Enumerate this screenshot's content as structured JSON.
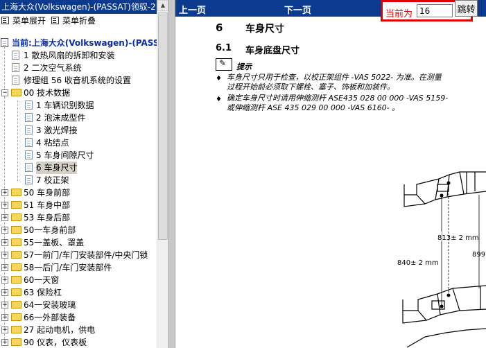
{
  "left_title": "上海大众(Volkswagen)-(PASSAT)领驭-2",
  "menu": {
    "expand": "菜单展开",
    "collapse": "菜单折叠"
  },
  "tree": {
    "root": "当前:上海大众(Volkswagen)-(PASSAT)",
    "items": [
      {
        "label": "1 散热风扇的拆卸和安装"
      },
      {
        "label": "2 二次空气系统"
      },
      {
        "label": "修理组  56 收音机系统的设置"
      },
      {
        "label": "00 技术数据"
      },
      {
        "label": "1 车辆识别数据"
      },
      {
        "label": "2 泡沫成型件"
      },
      {
        "label": "3 激光焊接"
      },
      {
        "label": "4 粘结点"
      },
      {
        "label": "5 车身间隙尺寸"
      },
      {
        "label": "6 车身尺寸"
      },
      {
        "label": "7 校正架"
      },
      {
        "label": "50 车身前部"
      },
      {
        "label": "51 车身中部"
      },
      {
        "label": "53 车身后部"
      },
      {
        "label": "50一车身前部"
      },
      {
        "label": "55一盖板、罩盖"
      },
      {
        "label": "57一前门/车门安装部件/中央门锁"
      },
      {
        "label": "58一后门/车门安装部件"
      },
      {
        "label": "60一天窗"
      },
      {
        "label": "63 保险杠"
      },
      {
        "label": "64一安装玻璃"
      },
      {
        "label": "66一外部装备"
      },
      {
        "label": "27 起动电机，供电"
      },
      {
        "label": "90 仪表，仪表板"
      }
    ]
  },
  "nav": {
    "prev": "上一页",
    "next": "下一页",
    "current_label": "当前为",
    "current_page": "16",
    "go": "跳转"
  },
  "document": {
    "section_num": "6",
    "section_title": "车身尺寸",
    "sub_num": "6.1",
    "sub_title": "车身底盘尺寸",
    "hint": "提示",
    "p1_line1": "车身尺寸只用于检查，以校正架组件 -VAS 5022- 为准。在测量",
    "p1_line2": "过程开始前必须取下螺栓、塞子、饰板和加装件。",
    "p2_line1": "确定车身尺寸时请用伸缩测杆 ASE435 028 00 000 -VAS 5159-",
    "p2_line2": "或伸缩测杆 ASE 435 029 00 000 -VAS 6160- 。",
    "dim1": "813± 2 mm",
    "dim2": "840± 2 mm",
    "dim3": "899"
  }
}
